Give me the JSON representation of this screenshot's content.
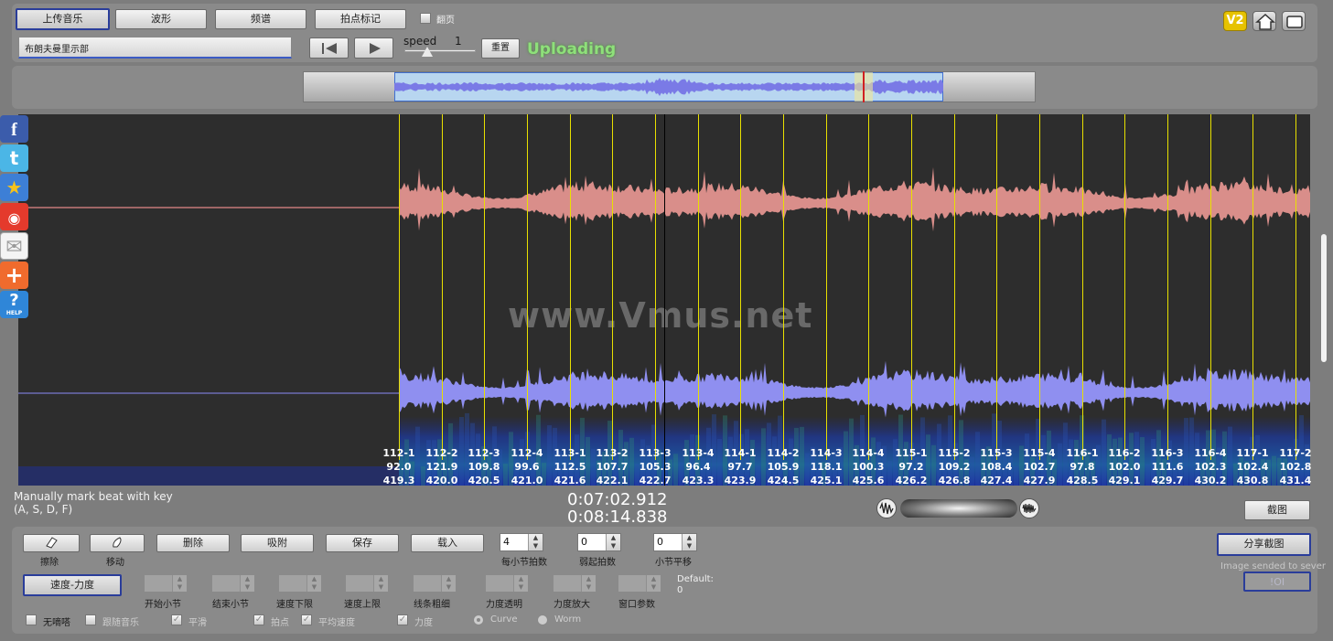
{
  "toolbar": {
    "tabs": [
      "上传音乐",
      "波形",
      "频谱",
      "拍点标记"
    ],
    "flip_label": "翻页",
    "song_title": "布朗夫曼里示部",
    "speed_label": "speed",
    "speed_value": "1",
    "reset_label": "重置",
    "status": "Uploading",
    "badge_v2": "V2"
  },
  "watermark": "www.Vmus.net",
  "hint": {
    "line1": "Manually mark beat with key",
    "line2": "(A, S, D, F)"
  },
  "time": {
    "current": "0:07:02.912",
    "total": "0:08:14.838"
  },
  "screenshot_button": "截图",
  "beats": [
    {
      "label": "112-1",
      "tempo": "92.0",
      "time": "419.3"
    },
    {
      "label": "112-2",
      "tempo": "121.9",
      "time": "420.0"
    },
    {
      "label": "112-3",
      "tempo": "109.8",
      "time": "420.5"
    },
    {
      "label": "112-4",
      "tempo": "99.6",
      "time": "421.0"
    },
    {
      "label": "113-1",
      "tempo": "112.5",
      "time": "421.6"
    },
    {
      "label": "113-2",
      "tempo": "107.7",
      "time": "422.1"
    },
    {
      "label": "113-3",
      "tempo": "105.3",
      "time": "422.7"
    },
    {
      "label": "113-4",
      "tempo": "96.4",
      "time": "423.3"
    },
    {
      "label": "114-1",
      "tempo": "97.7",
      "time": "423.9"
    },
    {
      "label": "114-2",
      "tempo": "105.9",
      "time": "424.5"
    },
    {
      "label": "114-3",
      "tempo": "118.1",
      "time": "425.1"
    },
    {
      "label": "114-4",
      "tempo": "100.3",
      "time": "425.6"
    },
    {
      "label": "115-1",
      "tempo": "97.2",
      "time": "426.2"
    },
    {
      "label": "115-2",
      "tempo": "109.2",
      "time": "426.8"
    },
    {
      "label": "115-3",
      "tempo": "108.4",
      "time": "427.4"
    },
    {
      "label": "115-4",
      "tempo": "102.7",
      "time": "427.9"
    },
    {
      "label": "116-1",
      "tempo": "97.8",
      "time": "428.5"
    },
    {
      "label": "116-2",
      "tempo": "102.0",
      "time": "429.1"
    },
    {
      "label": "116-3",
      "tempo": "111.6",
      "time": "429.7"
    },
    {
      "label": "116-4",
      "tempo": "102.3",
      "time": "430.2"
    },
    {
      "label": "117-1",
      "tempo": "102.4",
      "time": "430.8"
    },
    {
      "label": "117-2",
      "tempo": "102.8",
      "time": "431.4"
    }
  ],
  "bottom": {
    "erase_label": "擦除",
    "move_label": "移动",
    "delete_label": "删除",
    "snap_label": "吸附",
    "save_label": "保存",
    "load_label": "载入",
    "beats_per_bar_label": "每小节拍数",
    "beats_per_bar_value": "4",
    "pickup_label": "弱起拍数",
    "pickup_value": "0",
    "bar_shift_label": "小节平移",
    "bar_shift_value": "0",
    "tempo_force_label": "速度-力度",
    "start_bar_label": "开始小节",
    "end_bar_label": "结束小节",
    "tempo_lower_label": "速度下限",
    "tempo_upper_label": "速度上限",
    "line_width_label": "线条粗细",
    "force_alpha_label": "力度透明",
    "force_zoom_label": "力度放大",
    "window_param_label": "窗口参数",
    "default_label": "Default:",
    "default_value": "0",
    "options": [
      "无嘀嗒",
      "跟随音乐",
      "平滑",
      "拍点",
      "平均速度",
      "力度"
    ],
    "curve_label": "Curve",
    "worm_label": "Worm",
    "share_label": "分享截图",
    "share_note": "Image sended to sever",
    "ok_label": "!OI"
  },
  "colors": {
    "top_wave": "#d98e8a",
    "bottom_wave": "#8f8ff0",
    "beat_line": "#e8e000",
    "status_green": "#7bd06a",
    "share_border": "#2a3d9a"
  }
}
